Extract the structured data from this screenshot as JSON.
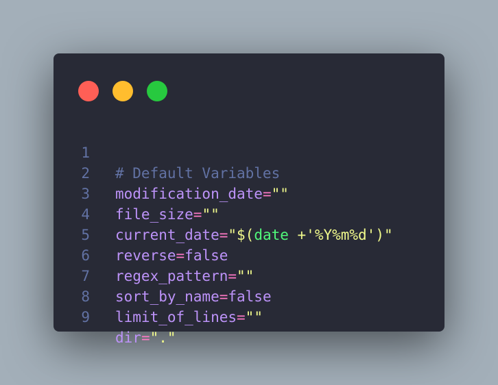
{
  "window": {
    "controls": {
      "close_color": "#ff5f56",
      "minimize_color": "#ffbd2e",
      "maximize_color": "#27c93f"
    }
  },
  "theme": {
    "background": "#282a36",
    "line_number": "#6272a4",
    "comment": "#6272a4",
    "variable": "#bd93f9",
    "operator": "#ff79c6",
    "string": "#f1fa8c",
    "command": "#50fa7b"
  },
  "code": {
    "lines": [
      {
        "number": "1",
        "comment": "# Default Variables"
      },
      {
        "number": "2",
        "name": "modification_date",
        "op": "=",
        "value": "\"\""
      },
      {
        "number": "3",
        "name": "file_size",
        "op": "=",
        "value": "\"\""
      },
      {
        "number": "4",
        "name": "current_date",
        "op": "=",
        "value_open": "\"$(",
        "cmd": "date",
        "value_close": " +'%Y%m%d')\""
      },
      {
        "number": "5",
        "name": "reverse",
        "op": "=",
        "value": "false"
      },
      {
        "number": "6",
        "name": "regex_pattern",
        "op": "=",
        "value": "\"\""
      },
      {
        "number": "7",
        "name": "sort_by_name",
        "op": "=",
        "value": "false"
      },
      {
        "number": "8",
        "name": "limit_of_lines",
        "op": "=",
        "value": "\"\""
      },
      {
        "number": "9",
        "name": "dir",
        "op": "=",
        "value": "\".\""
      }
    ]
  }
}
